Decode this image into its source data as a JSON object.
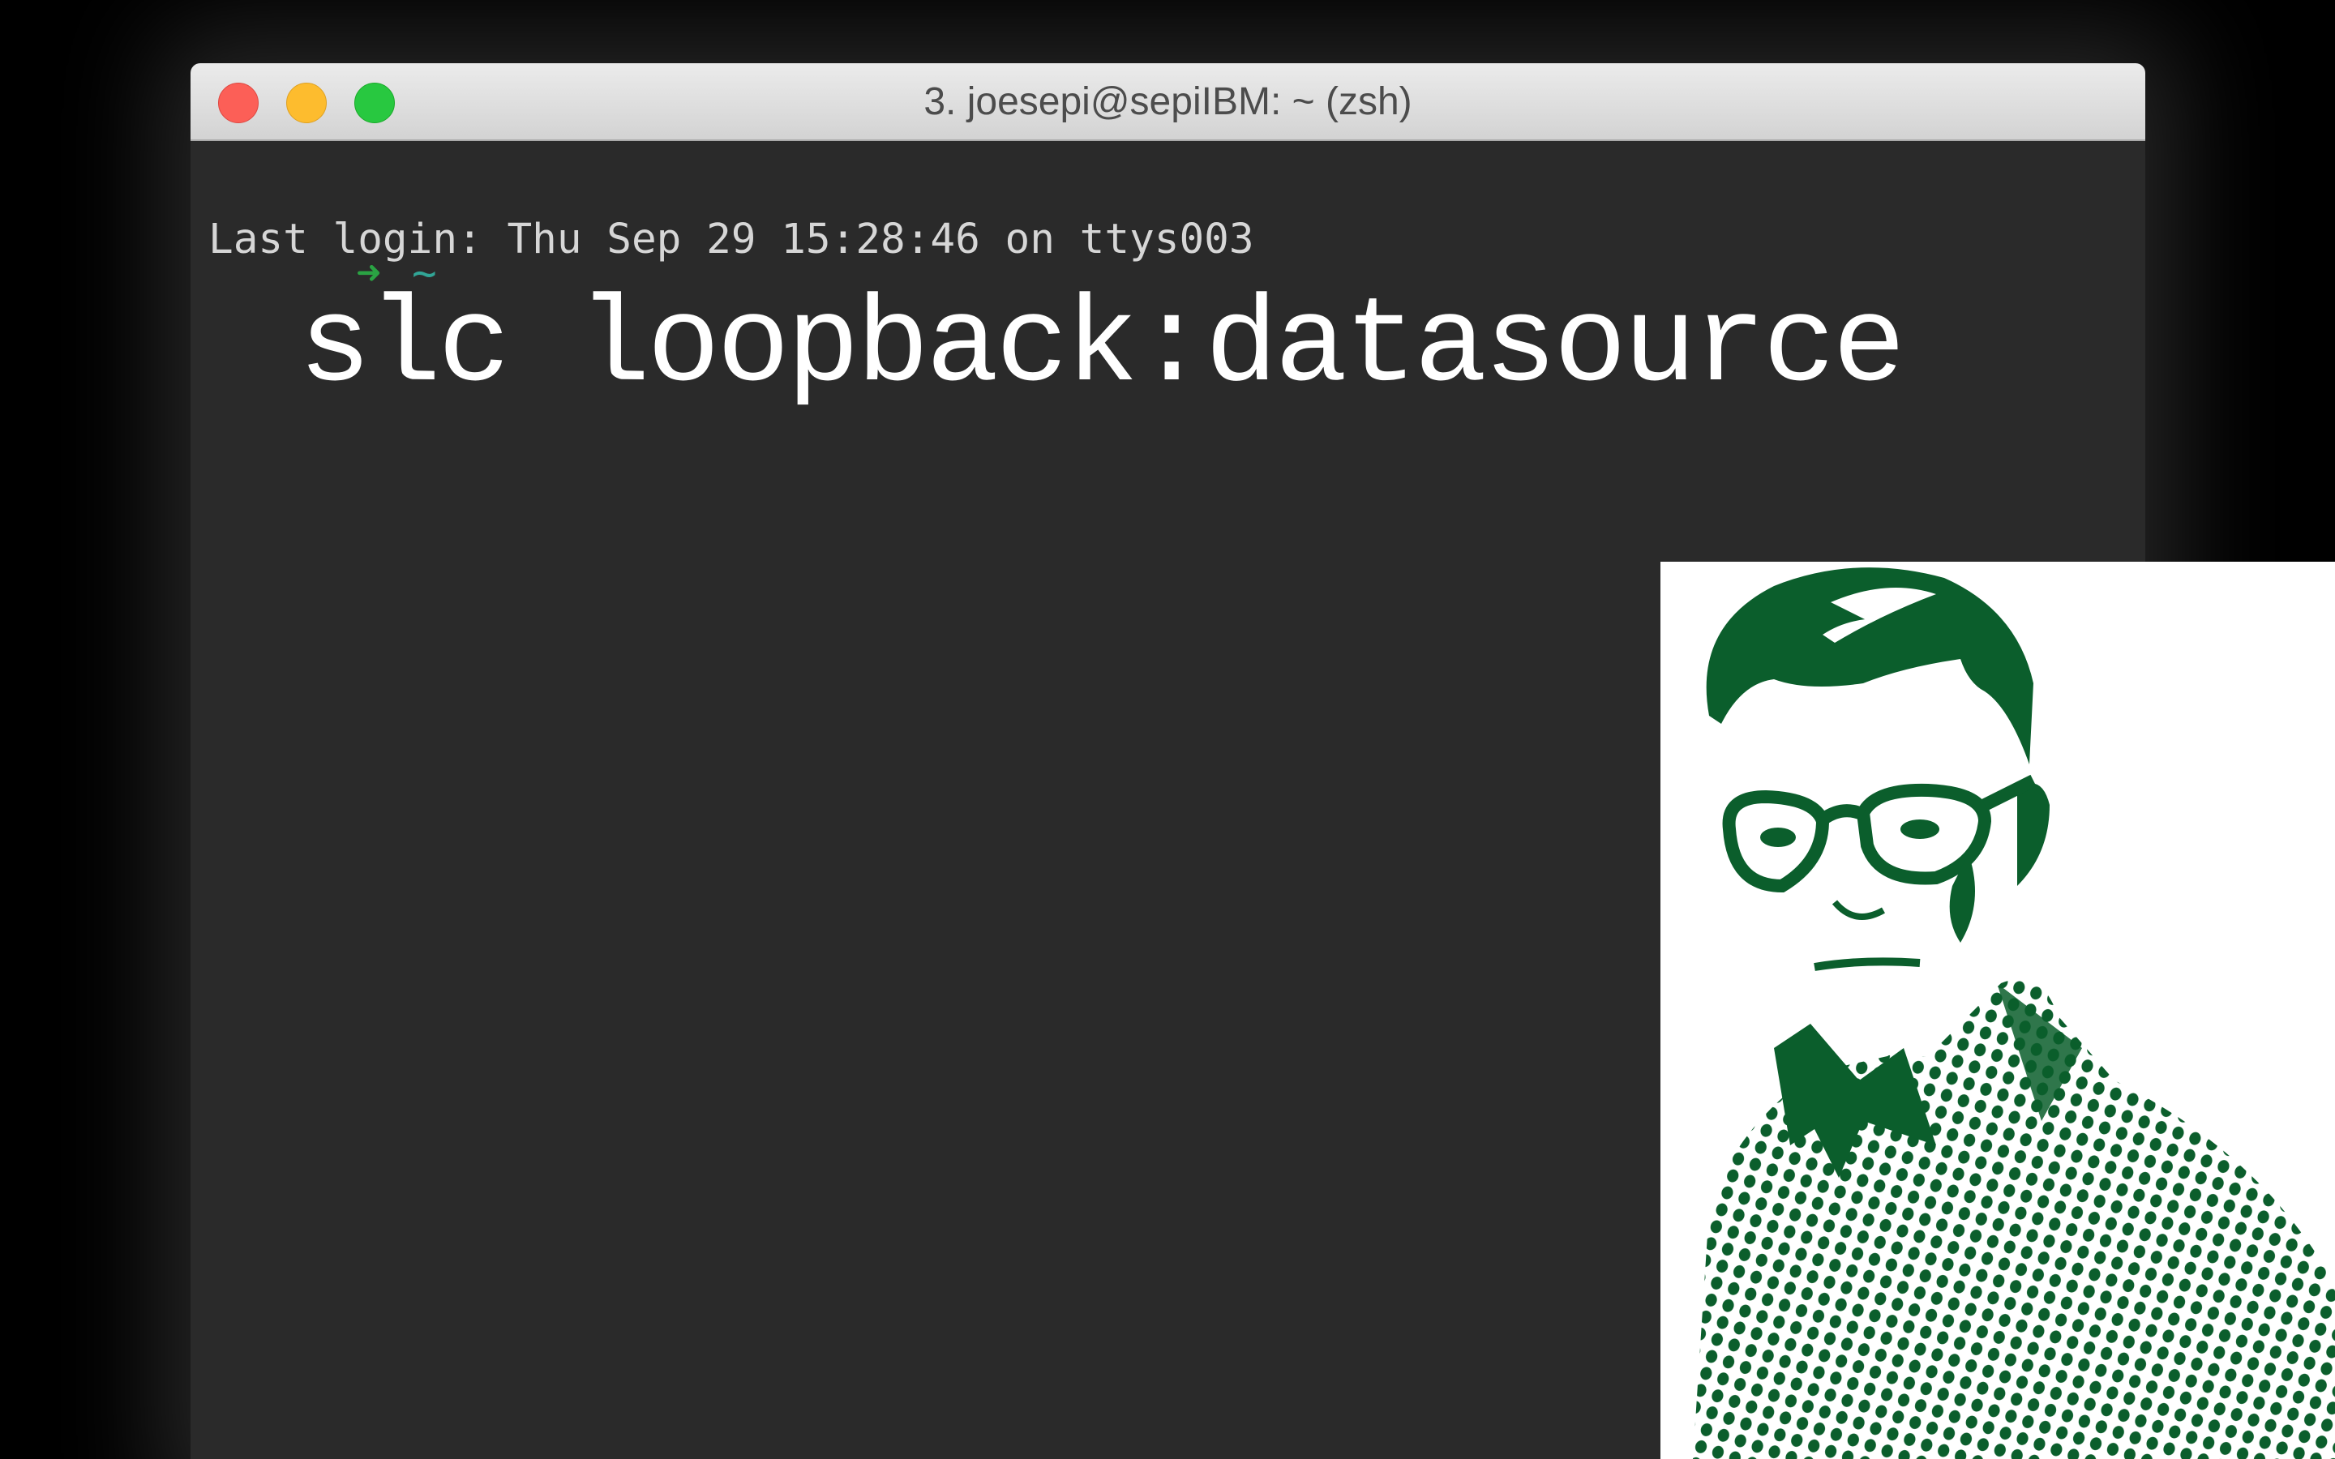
{
  "window": {
    "title": "3. joesepi@sepiIBM: ~ (zsh)",
    "buttons": {
      "close": "close-button",
      "minimize": "minimize-button",
      "zoom": "zoom-button"
    }
  },
  "terminal": {
    "login_line": "Last login: Thu Sep 29 15:28:46 on ttys003",
    "prompt_arrow": "➜",
    "prompt_dir": "~",
    "command": "slc loopback:datasource"
  },
  "colors": {
    "background": "#000000",
    "terminal_bg": "#2a2a2a",
    "titlebar": "#e0e0e0",
    "close": "#fc5f57",
    "minimize": "#fdbc2e",
    "zoom": "#28c840",
    "prompt_arrow": "#2aa343",
    "prompt_dir": "#31a596",
    "portrait_ink": "#0b5e2c"
  },
  "icons": {
    "prompt_arrow": "arrow-right-icon",
    "portrait": "person-portrait-illustration"
  }
}
